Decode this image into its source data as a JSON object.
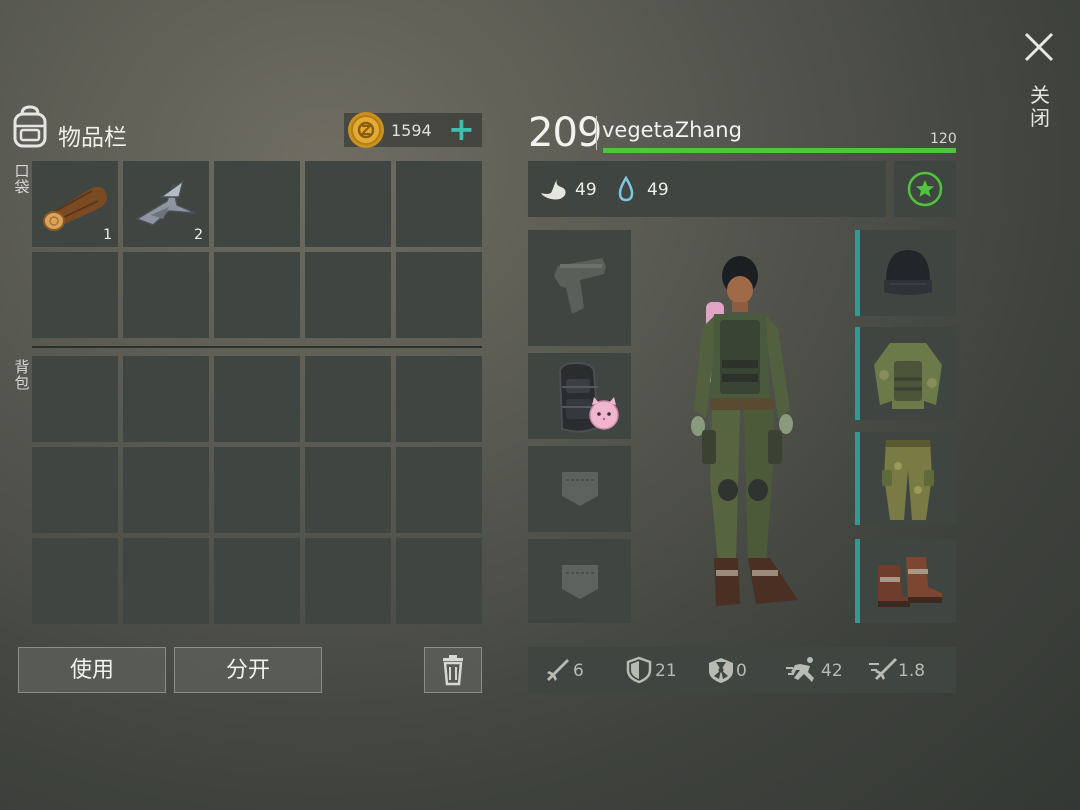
{
  "window": {
    "close_label": "关闭"
  },
  "inventory": {
    "title": "物品栏",
    "coins": "1594",
    "pocket_label": "口袋",
    "backpack_label": "背包",
    "pocket_items": [
      {
        "icon": "log-icon",
        "qty": "1"
      },
      {
        "icon": "metal-scrap-icon",
        "qty": "2"
      }
    ],
    "buttons": {
      "use": "使用",
      "split": "分开"
    }
  },
  "character": {
    "level": "209",
    "name": "vegetaZhang",
    "hp_max": "120",
    "hp_fraction": 1.0,
    "hunger": "49",
    "thirst": "49"
  },
  "stats": {
    "attack": "6",
    "armor": "21",
    "radiation": "0",
    "speed": "42",
    "crafting": "1.8"
  },
  "colors": {
    "accent_teal": "#3ec0b0",
    "hp_green": "#52c33e",
    "slot_bg": "#3f4540",
    "equip_bar": "#2f9c92"
  }
}
